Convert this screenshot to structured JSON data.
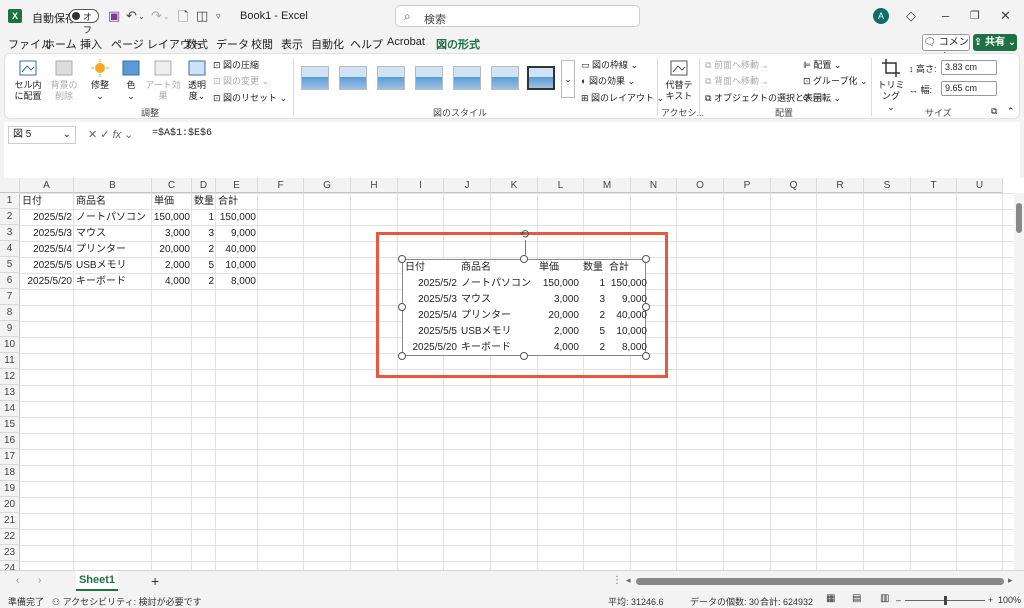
{
  "titlebar": {
    "app_icon": "X",
    "autosave_label": "自動保存",
    "autosave_state": "オフ",
    "doc_title": "Book1 - Excel",
    "search_placeholder": "検索",
    "avatar_letter": "A"
  },
  "menu": {
    "tabs": [
      "ファイル",
      "ホーム",
      "挿入",
      "ページ レイアウト",
      "数式",
      "データ",
      "校閲",
      "表示",
      "自動化",
      "ヘルプ",
      "Acrobat",
      "図の形式"
    ],
    "active_index": 11,
    "comment_label": "コメント",
    "share_label": "共有"
  },
  "ribbon": {
    "remove_bg_top": "セル内",
    "remove_bg_bottom": "に配置",
    "bg_remove_top": "背景の",
    "bg_remove_bottom": "削除",
    "corrections": "修整",
    "color": "色",
    "artistic": "アート効果",
    "transparency_top": "透明",
    "transparency_bottom": "度",
    "compress": "図の圧縮",
    "change": "図の変更",
    "reset": "図のリセット",
    "adjust_group": "調整",
    "border": "図の枠線",
    "effects": "図の効果",
    "layout": "図のレイアウト",
    "styles_group": "図のスタイル",
    "alt_text_top": "代替テ",
    "alt_text_bottom": "キスト",
    "access_group": "アクセシ...",
    "bring_forward": "前面へ移動",
    "send_backward": "背面へ移動",
    "selection_pane": "オブジェクトの選択と表示",
    "align": "配置",
    "group": "グループ化",
    "rotate": "回転",
    "arrange_group": "配置",
    "crop": "トリミング",
    "height_label": "高さ:",
    "height_value": "3.83 cm",
    "width_label": "幅:",
    "width_value": "9.65 cm",
    "size_group": "サイズ"
  },
  "formula_bar": {
    "name_box": "図 5",
    "formula": "=$A$1:$E$6"
  },
  "grid": {
    "columns": [
      "A",
      "B",
      "C",
      "D",
      "E",
      "F",
      "G",
      "H",
      "I",
      "J",
      "K",
      "L",
      "M",
      "N",
      "O",
      "P",
      "Q",
      "R",
      "S",
      "T",
      "U"
    ],
    "rows": [
      "1",
      "2",
      "3",
      "4",
      "5",
      "6",
      "7",
      "8",
      "9",
      "10",
      "11",
      "12",
      "13",
      "14",
      "15",
      "16",
      "17",
      "18",
      "19",
      "20",
      "21",
      "22",
      "23",
      "24"
    ],
    "headers": [
      "日付",
      "商品名",
      "単価",
      "数量",
      "合計"
    ],
    "data": [
      [
        "2025/5/2",
        "ノートパソコン",
        "150,000",
        "1",
        "150,000"
      ],
      [
        "2025/5/3",
        "マウス",
        "3,000",
        "3",
        "9,000"
      ],
      [
        "2025/5/4",
        "プリンター",
        "20,000",
        "2",
        "40,000"
      ],
      [
        "2025/5/5",
        "USBメモリ",
        "2,000",
        "5",
        "10,000"
      ],
      [
        "2025/5/20",
        "キーボード",
        "4,000",
        "2",
        "8,000"
      ]
    ]
  },
  "sheet": {
    "tab_name": "Sheet1",
    "add_label": "+"
  },
  "status": {
    "ready": "準備完了",
    "accessibility": "アクセシビリティ: 検討が必要です",
    "average": "平均: 31246.6",
    "count": "データの個数: 30",
    "sum": "合計: 624932",
    "zoom": "100%"
  },
  "colors": {
    "accent": "#1e7145",
    "highlight": "#e8573f"
  }
}
